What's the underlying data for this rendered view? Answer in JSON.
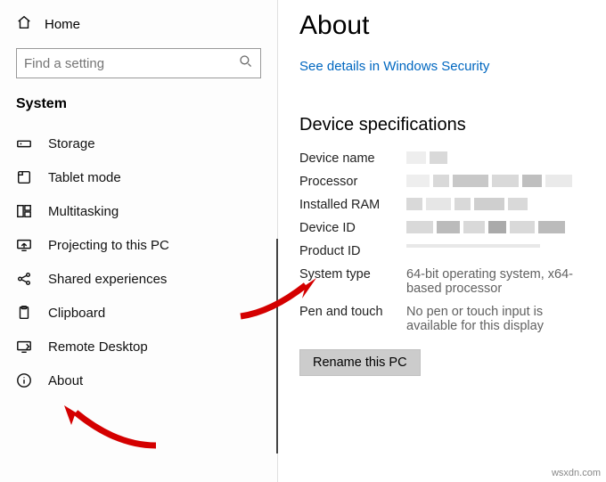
{
  "sidebar": {
    "home_label": "Home",
    "search_placeholder": "Find a setting",
    "section_title": "System",
    "items": [
      {
        "label": "Storage",
        "icon": "storage-icon"
      },
      {
        "label": "Tablet mode",
        "icon": "tablet-icon"
      },
      {
        "label": "Multitasking",
        "icon": "multitask-icon"
      },
      {
        "label": "Projecting to this PC",
        "icon": "project-icon"
      },
      {
        "label": "Shared experiences",
        "icon": "shared-icon"
      },
      {
        "label": "Clipboard",
        "icon": "clipboard-icon"
      },
      {
        "label": "Remote Desktop",
        "icon": "remote-icon"
      },
      {
        "label": "About",
        "icon": "about-icon"
      }
    ]
  },
  "main": {
    "title": "About",
    "security_link": "See details in Windows Security",
    "spec_heading": "Device specifications",
    "labels": {
      "device_name": "Device name",
      "processor": "Processor",
      "ram": "Installed RAM",
      "device_id": "Device ID",
      "product_id": "Product ID",
      "system_type": "System type",
      "pen_touch": "Pen and touch"
    },
    "values": {
      "system_type": "64-bit operating system, x64-based processor",
      "pen_touch": "No pen or touch input is available for this display"
    },
    "rename_btn": "Rename this PC"
  },
  "watermark": "wsxdn.com"
}
